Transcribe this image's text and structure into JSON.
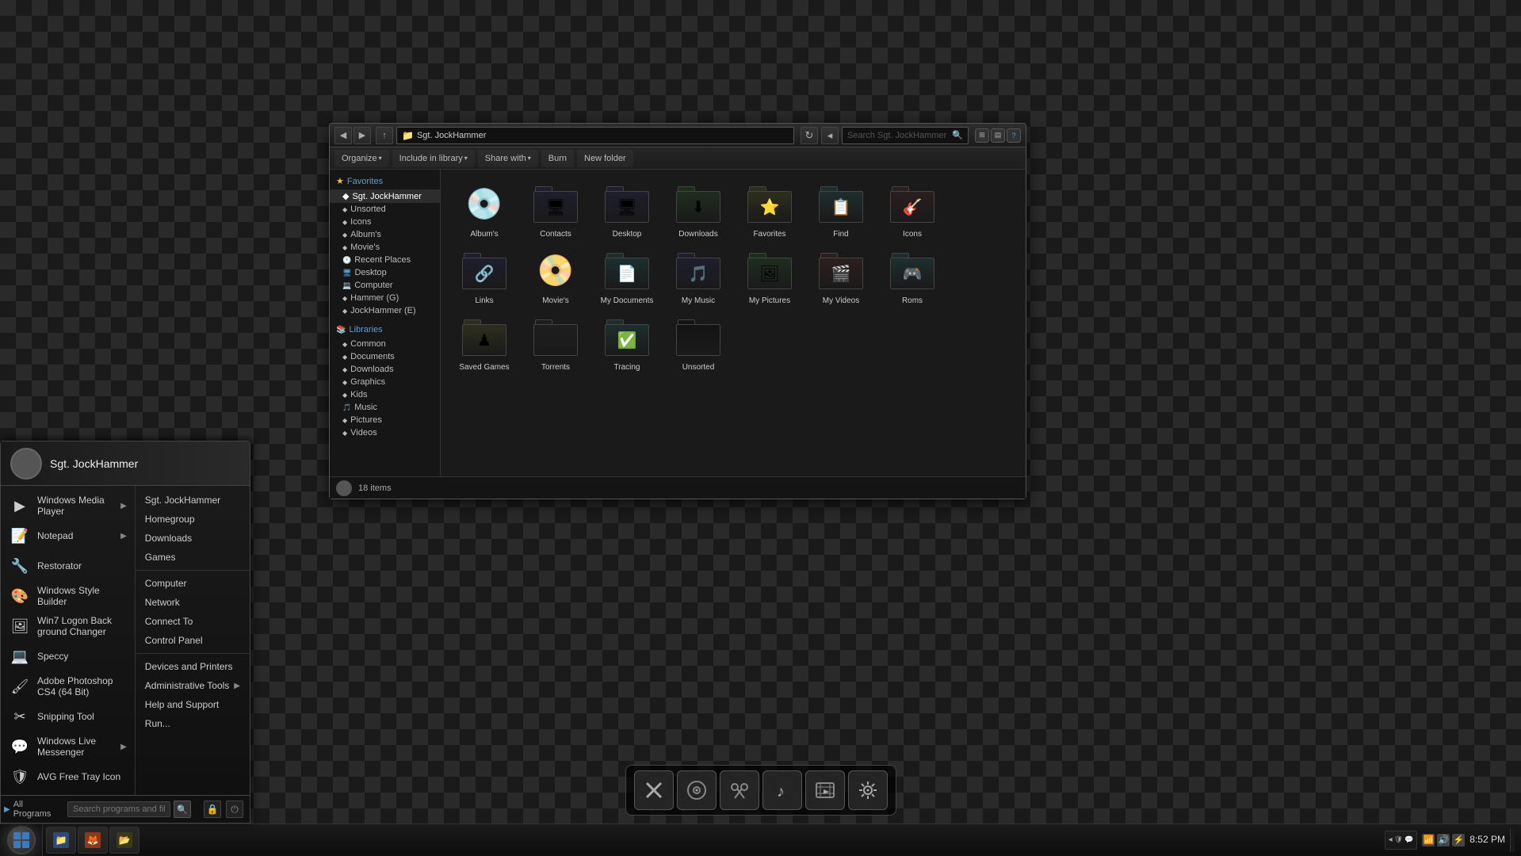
{
  "desktop": {
    "background": "checkerboard"
  },
  "taskbar": {
    "time": "8:52 PM",
    "start_label": "Start",
    "items": [
      {
        "label": "Sgt. JockHammer",
        "icon": "📁"
      },
      {
        "label": "Firefox",
        "icon": "🦊"
      }
    ],
    "tray_icons": [
      "🔊",
      "📶",
      "🔋",
      "💬"
    ]
  },
  "dock": {
    "buttons": [
      {
        "id": "x-btn",
        "label": "X",
        "icon": "✕"
      },
      {
        "id": "media-btn",
        "label": "Media",
        "icon": "⊙"
      },
      {
        "id": "tools-btn",
        "label": "Tools",
        "icon": "✂"
      },
      {
        "id": "music-btn",
        "label": "Music",
        "icon": "♪"
      },
      {
        "id": "video-btn",
        "label": "Video",
        "icon": "▶"
      },
      {
        "id": "settings-btn",
        "label": "Settings",
        "icon": "⚙"
      }
    ]
  },
  "start_menu": {
    "user": "Sgt. JockHammer",
    "search_placeholder": "Search programs and files",
    "all_programs": "All Programs",
    "left_items": [
      {
        "label": "Windows Media Player",
        "icon": "▶",
        "has_arrow": true
      },
      {
        "label": "Notepad",
        "icon": "📝",
        "has_arrow": true
      },
      {
        "label": "Restorator",
        "icon": "🔧",
        "has_arrow": false
      },
      {
        "label": "Windows Style Builder",
        "icon": "🎨",
        "has_arrow": false
      },
      {
        "label": "Win7 Logon Back ground Changer",
        "icon": "🖼",
        "has_arrow": false
      },
      {
        "label": "Speccy",
        "icon": "💻",
        "has_arrow": false
      },
      {
        "label": "Adobe Photoshop CS4 (64 Bit)",
        "icon": "🖌",
        "has_arrow": false
      },
      {
        "label": "Snipping Tool",
        "icon": "✂",
        "has_arrow": false
      },
      {
        "label": "Windows Live Messenger",
        "icon": "💬",
        "has_arrow": true
      },
      {
        "label": "AVG Free Tray Icon",
        "icon": "🛡",
        "has_arrow": false
      }
    ],
    "right_items": [
      {
        "label": "Sgt. JockHammer",
        "has_arrow": false
      },
      {
        "label": "Homegroup",
        "has_arrow": false
      },
      {
        "label": "Downloads",
        "has_arrow": false
      },
      {
        "label": "Games",
        "has_arrow": false
      },
      {
        "label": "Computer",
        "has_arrow": false
      },
      {
        "label": "Network",
        "has_arrow": false
      },
      {
        "label": "Connect To",
        "has_arrow": false
      },
      {
        "label": "Control Panel",
        "has_arrow": false
      },
      {
        "label": "Devices and Printers",
        "has_arrow": false
      },
      {
        "label": "Administrative Tools",
        "has_arrow": true
      },
      {
        "label": "Help and Support",
        "has_arrow": false
      },
      {
        "label": "Run...",
        "has_arrow": false
      }
    ]
  },
  "explorer": {
    "title": "Sgt. JockHammer",
    "search_placeholder": "Search Sgt. JockHammer",
    "address": "Sgt. JockHammer",
    "toolbar": [
      "Organize ▾",
      "Include in library ▾",
      "Share with ▾",
      "Burn",
      "New folder"
    ],
    "status": "18 items",
    "nav": {
      "favorites_label": "Favorites",
      "favorites_items": [
        "Sgt. JockHammer",
        "Unsorted",
        "Icons",
        "Album's",
        "Movie's",
        "Recent Places"
      ],
      "system_items": [
        "Desktop",
        "Computer",
        "Hammer (G)",
        "JockHammer (E)"
      ],
      "libraries_label": "Libraries",
      "libraries_items": [
        "Common",
        "Documents",
        "Downloads",
        "Graphics",
        "Kids",
        "Music",
        "Pictures",
        "Videos"
      ]
    },
    "files": [
      {
        "name": "Album's",
        "icon": "💿",
        "type": "cd"
      },
      {
        "name": "Contacts",
        "icon": "🖥",
        "type": "folder-img"
      },
      {
        "name": "Desktop",
        "icon": "🖥",
        "type": "folder-desktop"
      },
      {
        "name": "Downloads",
        "icon": "⬇",
        "type": "folder-dl"
      },
      {
        "name": "Favorites",
        "icon": "⭐",
        "type": "folder-fav"
      },
      {
        "name": "Find",
        "icon": "📋",
        "type": "folder-note"
      },
      {
        "name": "Icons",
        "icon": "🎸",
        "type": "folder-guitar"
      },
      {
        "name": "Links",
        "icon": "🔵",
        "type": "folder-links"
      },
      {
        "name": "Movie's",
        "icon": "💿",
        "type": "dvd"
      },
      {
        "name": "My Documents",
        "icon": "📄",
        "type": "folder-doc"
      },
      {
        "name": "My Music",
        "icon": "🎵",
        "type": "folder-music"
      },
      {
        "name": "My Pictures",
        "icon": "🖼",
        "type": "folder-pics"
      },
      {
        "name": "My Videos",
        "icon": "🎬",
        "type": "folder-vid"
      },
      {
        "name": "Roms",
        "icon": "🎮",
        "type": "folder-roms"
      },
      {
        "name": "Saved Games",
        "icon": "♟",
        "type": "folder-games"
      },
      {
        "name": "Torrents",
        "icon": "📁",
        "type": "folder"
      },
      {
        "name": "Tracing",
        "icon": "✅",
        "type": "folder-trace"
      },
      {
        "name": "Unsorted",
        "icon": "📁",
        "type": "folder-dark"
      }
    ]
  }
}
